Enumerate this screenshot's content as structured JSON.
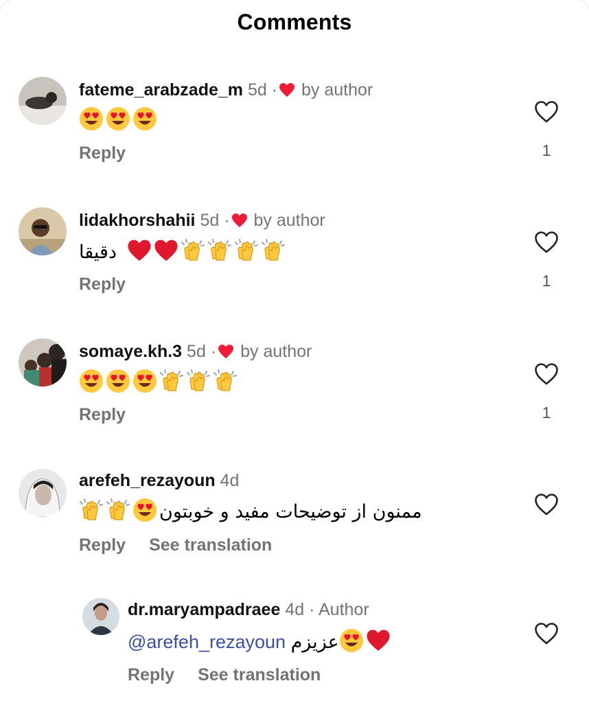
{
  "header": {
    "title": "Comments"
  },
  "labels": {
    "reply": "Reply",
    "see_translation": "See translation",
    "by_author": "by author",
    "author": "Author"
  },
  "comments": [
    {
      "username": "fateme_arabzade_m",
      "time": "5d",
      "liked_by_author": true,
      "emojis": [
        "heart-eyes-emoji",
        "heart-eyes-emoji",
        "heart-eyes-emoji"
      ],
      "text": "",
      "likes": "1"
    },
    {
      "username": "lidakhorshahii",
      "time": "5d",
      "liked_by_author": true,
      "emojis": [
        "red-heart-emoji",
        "red-heart-emoji",
        "clapping-hands-emoji",
        "clapping-hands-emoji",
        "clapping-hands-emoji",
        "clapping-hands-emoji"
      ],
      "text": "دقیقا",
      "likes": "1"
    },
    {
      "username": "somaye.kh.3",
      "time": "5d",
      "liked_by_author": true,
      "emojis": [
        "heart-eyes-emoji",
        "heart-eyes-emoji",
        "heart-eyes-emoji",
        "clapping-hands-emoji",
        "clapping-hands-emoji",
        "clapping-hands-emoji"
      ],
      "text": "",
      "likes": "1"
    },
    {
      "username": "arefeh_rezayoun",
      "time": "4d",
      "liked_by_author": false,
      "emojis": [
        "clapping-hands-emoji",
        "clapping-hands-emoji",
        "heart-eyes-emoji"
      ],
      "text": "ممنون از توضیحات مفید و خوبتون",
      "likes": ""
    }
  ],
  "reply": {
    "username": "dr.maryampadraee",
    "time": "4d",
    "mention": "@arefeh_rezayoun",
    "text": "عزیزم",
    "emojis": [
      "heart-eyes-emoji",
      "red-heart-emoji"
    ]
  },
  "colors": {
    "like_red": "#ed1c3a",
    "mention_blue": "#3d4ea6",
    "muted": "#737373"
  }
}
